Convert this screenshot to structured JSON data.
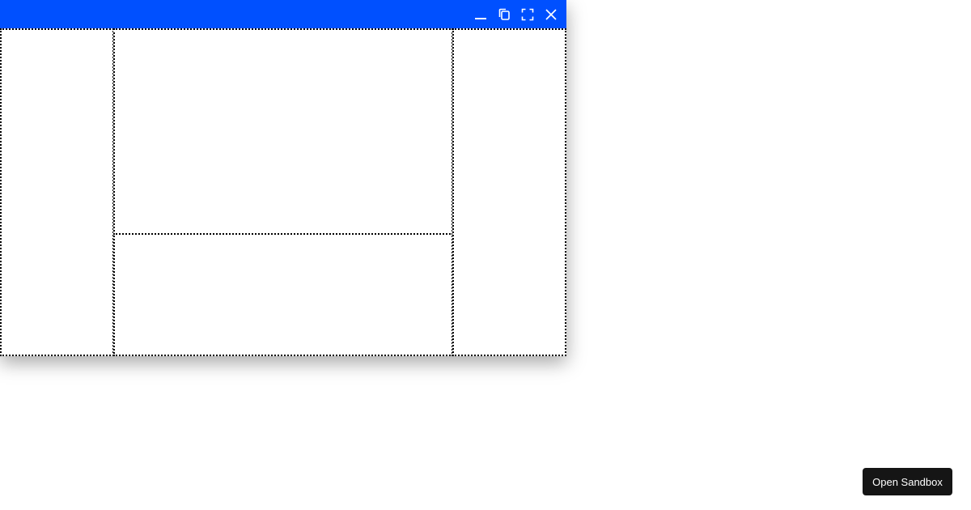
{
  "colors": {
    "titlebar": "#0050ff",
    "icon": "#ffffff",
    "pane_border": "#000000",
    "sandbox_bg": "#151515"
  },
  "window": {
    "controls": [
      {
        "name": "minimize",
        "icon": "minimize-icon"
      },
      {
        "name": "restore",
        "icon": "restore-icon"
      },
      {
        "name": "fullscreen",
        "icon": "fullscreen-icon"
      },
      {
        "name": "close",
        "icon": "close-icon"
      }
    ]
  },
  "sandbox_button": {
    "label": "Open Sandbox"
  }
}
